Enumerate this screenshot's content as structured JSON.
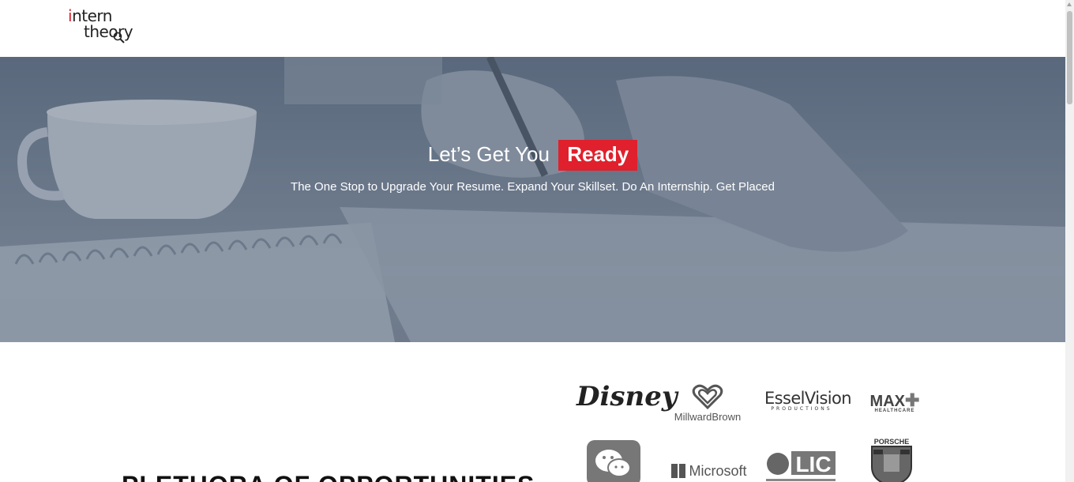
{
  "header": {
    "logo_line1": "intern",
    "logo_line2": "theory"
  },
  "hero": {
    "title_prefix": "Let’s Get You",
    "title_highlight": "Ready",
    "subtitle": "The One Stop to Upgrade Your Resume. Expand Your Skillset. Do An Internship. Get Placed",
    "highlight_color": "#e0202c"
  },
  "section": {
    "title": "PLETHORA OF OPPORTUNITIES"
  },
  "partners": {
    "disney": "Disney",
    "millward": "MillwardBrown",
    "essel": "EsselVision",
    "essel_sub": "PRODUCTIONS",
    "max": "MAX",
    "max_sub": "HEALTHCARE",
    "microsoft": "Microsoft",
    "lic": "LIC",
    "porsche": "PORSCHE"
  }
}
